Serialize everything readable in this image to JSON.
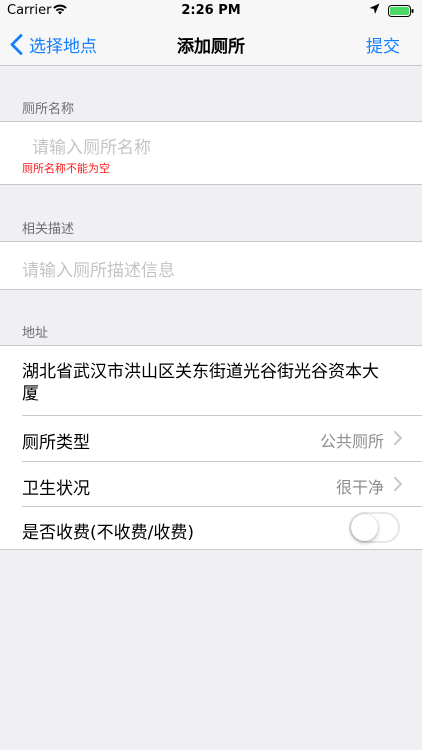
{
  "status_bar": {
    "carrier": "Carrier",
    "time": "2:26 PM",
    "wifi_icon": "wifi-icon",
    "location_icon": "location-arrow-icon",
    "battery_icon": "battery-icon"
  },
  "nav": {
    "back_label": "选择地点",
    "title": "添加厕所",
    "submit_label": "提交"
  },
  "name_section": {
    "header": "厕所名称",
    "placeholder": "请输入厕所名称",
    "error": "厕所名称不能为空"
  },
  "desc_section": {
    "header": "相关描述",
    "placeholder": "请输入厕所描述信息"
  },
  "address_section": {
    "header": "地址",
    "address_line1": "湖北省武汉市洪山区关东街道光谷街光谷资本大",
    "address_line2": "厦",
    "type_label": "厕所类型",
    "type_value": "公共厕所",
    "hygiene_label": "卫生状况",
    "hygiene_value": "很干净",
    "fee_label": "是否收费(不收费/收费)",
    "fee_on": false
  },
  "colors": {
    "accent": "#147efb",
    "error": "#ff1a1a",
    "background": "#efeff4"
  }
}
